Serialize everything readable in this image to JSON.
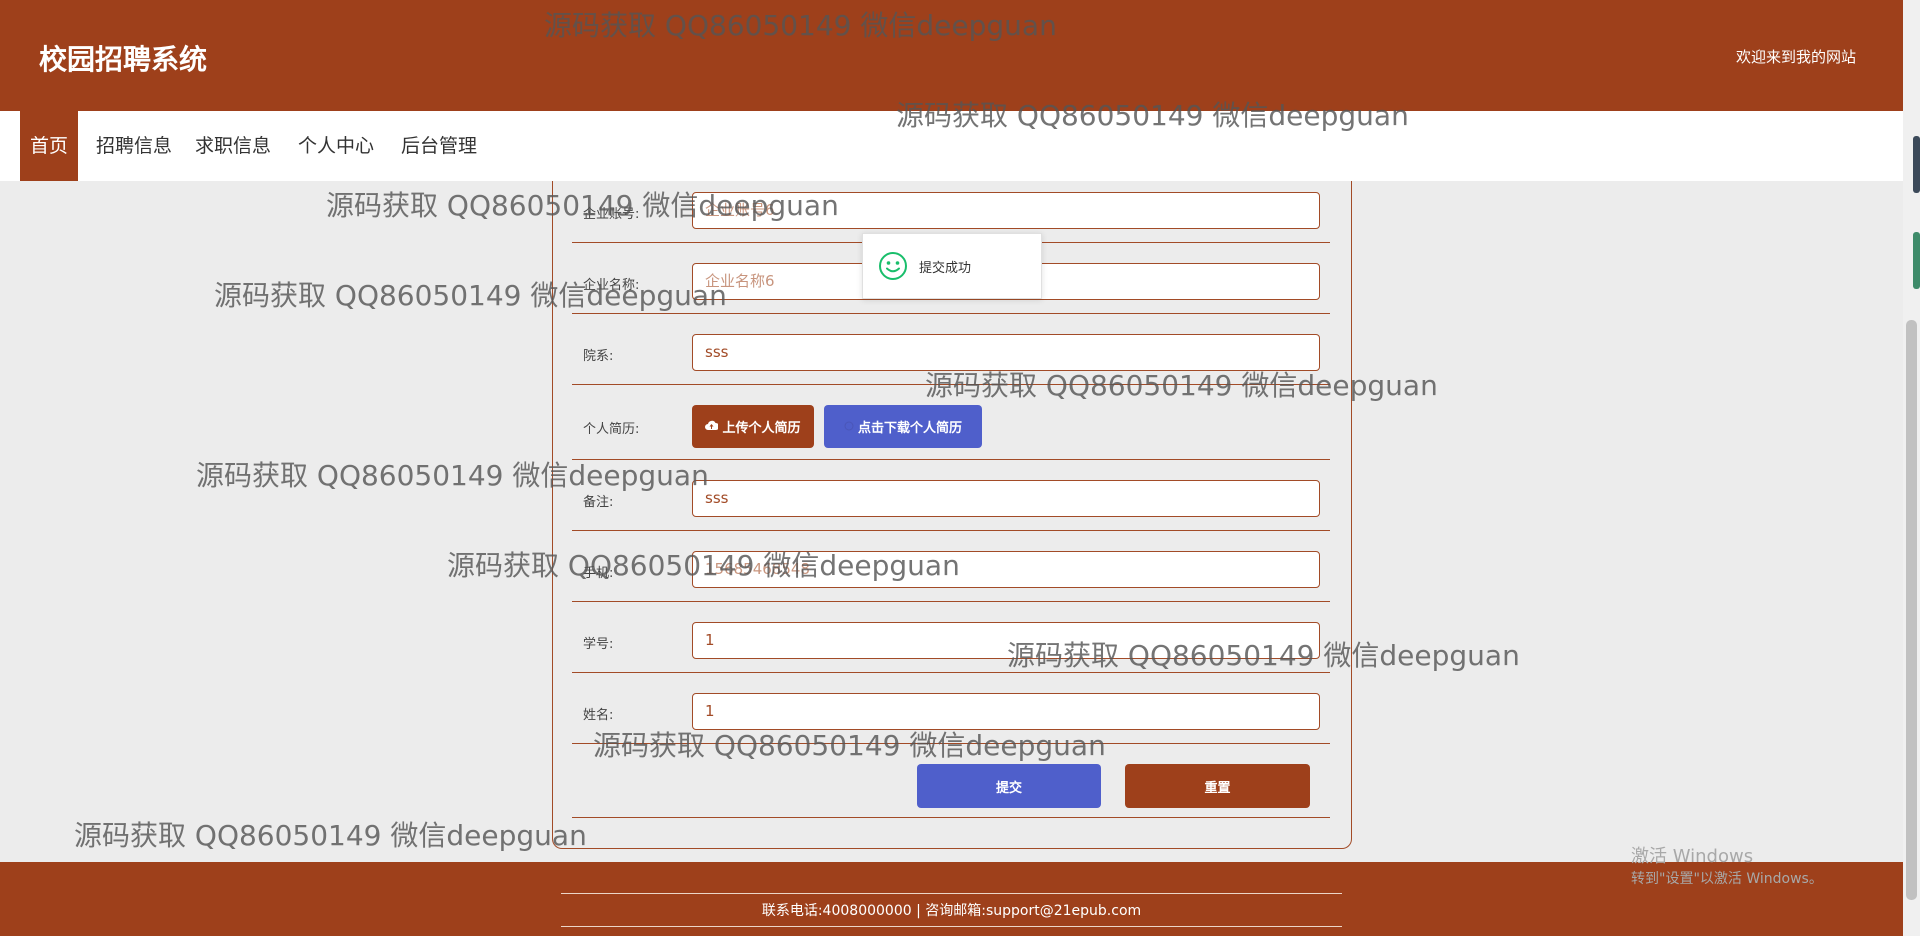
{
  "header": {
    "site_title": "校园招聘系统",
    "welcome": "欢迎来到我的网站"
  },
  "nav": {
    "items": [
      "首页",
      "招聘信息",
      "求职信息",
      "个人中心",
      "后台管理"
    ],
    "active": "首页"
  },
  "form": {
    "company_account_label": "企业账号:",
    "company_account_value": "企业账号6",
    "company_name_label": "企业名称:",
    "company_name_value": "企业名称6",
    "department_label": "院系:",
    "department_value": "sss",
    "resume_label": "个人简历:",
    "upload_resume_button": "上传个人简历",
    "download_resume_button": "点击下载个人简历",
    "remark_label": "备注:",
    "remark_value": "sss",
    "phone_label": "手机:",
    "phone_value": "15685468548",
    "student_no_label": "学号:",
    "student_no_value": "1",
    "name_label": "姓名:",
    "name_value": "1",
    "submit_button": "提交",
    "reset_button": "重置"
  },
  "toast": {
    "message": "提交成功",
    "icon": "smile-icon",
    "color": "#19be6b"
  },
  "watermark": {
    "text": "源码获取 QQ86050149 微信deepguan"
  },
  "footer": {
    "contact": "联系电话:4008000000 | 咨询邮箱:support@21epub.com"
  },
  "os_overlay": {
    "activate_title": "激活 Windows",
    "activate_sub": "转到\"设置\"以激活 Windows。"
  },
  "colors": {
    "brand": "#9e401b",
    "accent_blue": "#4f5fcb",
    "page_bg": "#ececec"
  }
}
